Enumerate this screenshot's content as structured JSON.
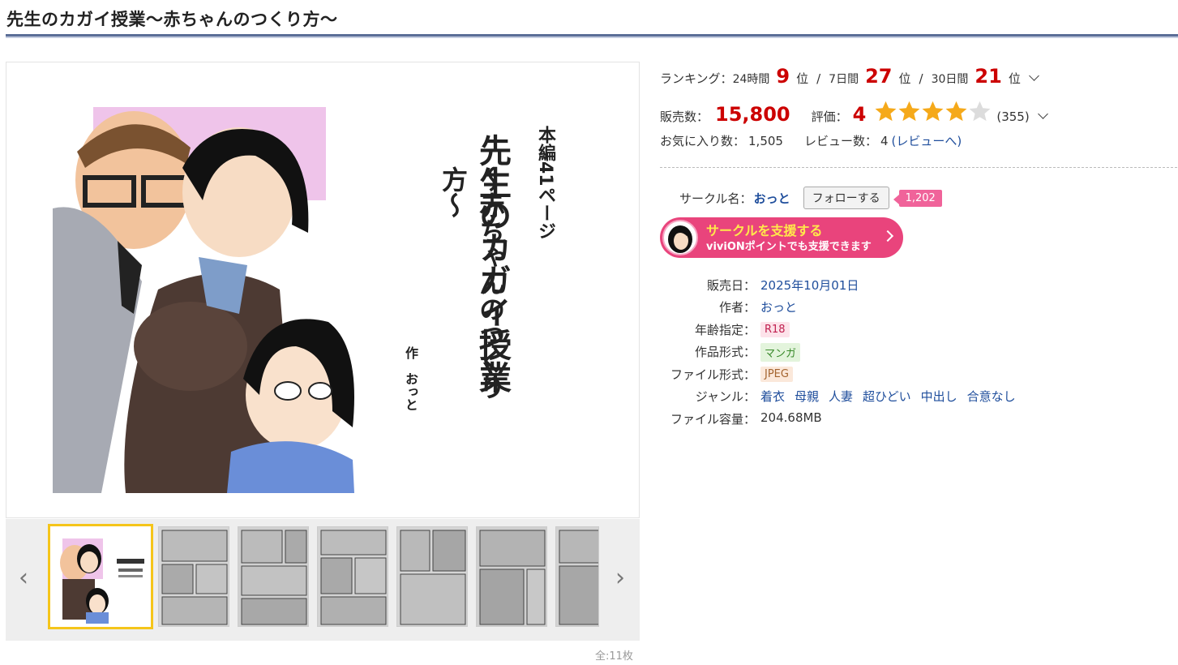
{
  "page": {
    "title": "先生のカガイ授業〜赤ちゃんのつくり方〜"
  },
  "cover": {
    "text_pages": "本編41ページ",
    "text_title_1": "先生のカガイ授業",
    "text_title_2": "〜赤ちゃんのつくり方〜",
    "text_author": "作　おっと"
  },
  "gallery": {
    "prev_icon": "chevron-left-icon",
    "next_icon": "chevron-right-icon",
    "count": "全:11枚",
    "thumbnails": [
      "cover",
      "page-1",
      "page-2",
      "page-3",
      "page-4",
      "page-5",
      "page-6"
    ]
  },
  "ranking": {
    "label": "ランキング：",
    "d24_label": "24時間",
    "d24_value": "9",
    "d24_unit": "位",
    "sep1": "/",
    "d7_label": "7日間",
    "d7_value": "27",
    "d7_unit": "位",
    "sep2": "/",
    "d30_label": "30日間",
    "d30_value": "21",
    "d30_unit": "位"
  },
  "sales": {
    "label": "販売数：",
    "value": "15,800"
  },
  "rating": {
    "label": "評価：",
    "value": "4",
    "stars": 4,
    "max_stars": 5,
    "count": "(355)",
    "star_color": "#f5a91a"
  },
  "favorites": {
    "label": "お気に入り数：",
    "value": "1,505"
  },
  "reviews": {
    "label": "レビュー数：",
    "value": "4",
    "link_prefix": "(",
    "link": "レビューへ",
    "link_suffix": ")"
  },
  "circle": {
    "label": "サークル名：",
    "name": "おっと",
    "follow_label": "フォローする",
    "follow_count": "1,202"
  },
  "support": {
    "main": "サークルを支援する",
    "sub": "viviONポイントでも支援できます"
  },
  "specs": {
    "release_label": "販売日：",
    "release_value": "2025年10月01日",
    "author_label": "作者：",
    "author_value": "おっと",
    "age_label": "年齢指定：",
    "age_value": "R18",
    "format_label": "作品形式：",
    "format_value": "マンガ",
    "file_label": "ファイル形式：",
    "file_value": "JPEG",
    "genre_label": "ジャンル：",
    "genres": [
      "着衣",
      "母親",
      "人妻",
      "超ひどい",
      "中出し",
      "合意なし"
    ],
    "size_label": "ファイル容量：",
    "size_value": "204.68MB"
  },
  "colors": {
    "accent_red": "#cc0000",
    "link": "#1f4e9c",
    "support_pink": "#e9447c",
    "title_rule": "#5b6e97"
  }
}
